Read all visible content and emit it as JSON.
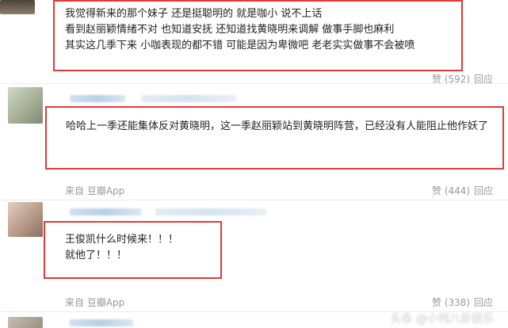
{
  "comments": [
    {
      "lines": [
        "我觉得新来的那个妹子 还是挺聪明的 就是咖小 说不上话",
        "看到赵丽颖情绪不对 也知道安抚 还知道找黄晓明来调解 做事手脚也麻利",
        "其实这几季下来 小咖表现的都不错 可能是因为卑微吧 老老实实做事不会被喷"
      ],
      "source": "",
      "likes": "赞 (592)",
      "reply": "回应"
    },
    {
      "lines": [
        "哈哈上一季还能集体反对黄晓明，这一季赵丽颖站到黄晓明阵营，已经没有人能阻止他作妖了"
      ],
      "source": "来自 豆瓣App",
      "likes": "赞 (444)",
      "reply": "回应"
    },
    {
      "lines": [
        "王俊凯什么时候来！！！",
        "就他了！！！"
      ],
      "source": "来自 豆瓣App",
      "likes": "赞 (338)",
      "reply": "回应"
    }
  ],
  "watermark": "头条 @小鸭八卦娱乐"
}
